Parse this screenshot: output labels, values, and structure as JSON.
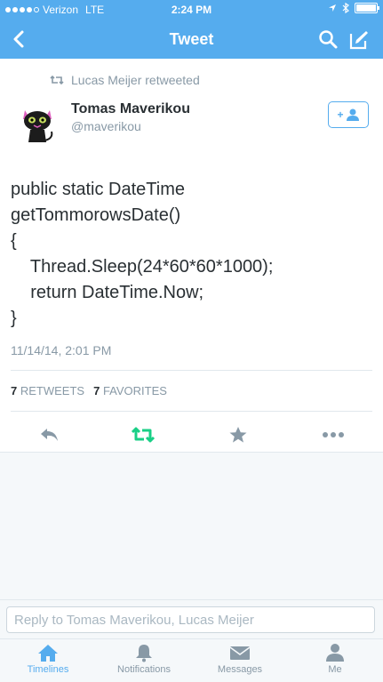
{
  "status_bar": {
    "carrier": "Verizon",
    "network": "LTE",
    "time": "2:24 PM"
  },
  "nav": {
    "title": "Tweet"
  },
  "tweet": {
    "retweeted_by": "Lucas Meijer retweeted",
    "author_name": "Tomas Maverikou",
    "author_handle": "@maverikou",
    "follow_label": "+",
    "body_lines": [
      "public static DateTime",
      "getTommorowsDate()",
      "{",
      "    Thread.Sleep(24*60*60*1000);",
      "    return DateTime.Now;",
      "}"
    ],
    "timestamp": "11/14/14, 2:01 PM",
    "retweets_count": "7",
    "retweets_label": "RETWEETS",
    "favorites_count": "7",
    "favorites_label": "FAVORITES"
  },
  "reply": {
    "placeholder": "Reply to Tomas Maverikou, Lucas Meijer"
  },
  "tabs": [
    {
      "label": "Timelines",
      "icon": "home-icon",
      "active": true
    },
    {
      "label": "Notifications",
      "icon": "bell-icon",
      "active": false
    },
    {
      "label": "Messages",
      "icon": "envelope-icon",
      "active": false
    },
    {
      "label": "Me",
      "icon": "person-icon",
      "active": false
    }
  ],
  "colors": {
    "brand": "#55acee",
    "retweet_green": "#19cf86",
    "muted": "#8899a6"
  }
}
